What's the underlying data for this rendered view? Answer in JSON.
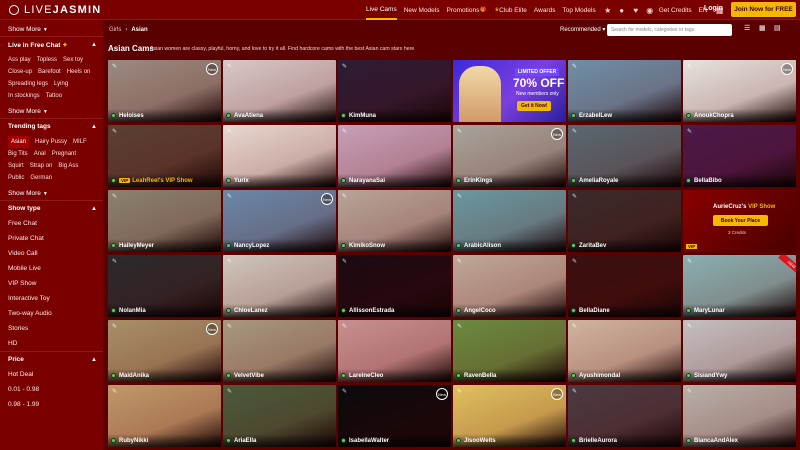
{
  "header": {
    "logo_a": "LIVE",
    "logo_b": "JASMIN",
    "nav": [
      {
        "label": "Live Cams",
        "active": true
      },
      {
        "label": "New Models"
      },
      {
        "label": "Promotions"
      },
      {
        "label": "Club Elite"
      },
      {
        "label": "Awards"
      },
      {
        "label": "Top Models"
      }
    ],
    "get_credits": "Get Credits",
    "lang": "EN",
    "login": "Login",
    "join": "Join Now for FREE"
  },
  "sidebar": {
    "show_more_top": "Show More",
    "free_chat_title": "Live in Free Chat",
    "free_chat_tags": [
      "Ass play",
      "Topless",
      "Sex toy",
      "Close-up",
      "Barefoot",
      "Heels on",
      "Spreading legs",
      "Lying",
      "In stockings",
      "Tattoo"
    ],
    "show_more_1": "Show More",
    "trending_title": "Trending tags",
    "trending_tags": [
      "Asian",
      "Hairy Pussy",
      "MILF",
      "Big Tits",
      "Anal",
      "Pregnant",
      "Squirt",
      "Strap on",
      "Big Ass",
      "Public",
      "German"
    ],
    "show_more_2": "Show More",
    "show_type_title": "Show type",
    "show_types": [
      "Free Chat",
      "Private Chat",
      "Video Call",
      "Mobile Live",
      "VIP Show",
      "Interactive Toy",
      "Two-way Audio",
      "Stories",
      "HD"
    ],
    "price_title": "Price",
    "prices": [
      "Hot Deal",
      "0.01 - 0.98",
      "0.98 - 1.99"
    ]
  },
  "main": {
    "breadcrumb_parent": "Girls",
    "breadcrumb_current": "Asian",
    "sort": "Recommended",
    "search_placeholder": "Search for models, categories or tags",
    "title": "Asian Cams",
    "description": "Asian women are classy, playful, horny, and love to try it all. Find hardcore cams with the best Asian cam stars here",
    "promo": {
      "badge": "LIMITED OFFER",
      "off": "70% OFF",
      "sub": "New members only",
      "btn": "Get it Now!"
    },
    "vip": {
      "name": "AurieCruz's",
      "vip": "VIP Show",
      "btn": "Book Your Place",
      "credits": "3 Credits",
      "tag": "VIP"
    },
    "cards": [
      {
        "name": "Heloises",
        "bg": "#9a8a80",
        "new": true
      },
      {
        "name": "AvaAtiena",
        "bg": "#d8c8c8"
      },
      {
        "name": "KimMuna",
        "bg": "#2c1c34"
      },
      {
        "name": "ErzabelLew",
        "bg": "#6f8fa8"
      },
      {
        "name": "AnoukChopra",
        "bg": "#e6e2de",
        "new": true
      },
      {
        "name": "LeahReel's VIP Show",
        "bg": "#5a4034",
        "vip": true
      },
      {
        "name": "Yurix",
        "bg": "#e8d8d0"
      },
      {
        "name": "NarayanaSai",
        "bg": "#c8a0b8"
      },
      {
        "name": "ErinKings",
        "bg": "#a8a49a",
        "new": true
      },
      {
        "name": "AmeliaRoyale",
        "bg": "#5a6870"
      },
      {
        "name": "BellaBibo",
        "bg": "#4a1a4a"
      },
      {
        "name": "HaileyMeyer",
        "bg": "#8a8270"
      },
      {
        "name": "NancyLopez",
        "bg": "#6a88a8",
        "new": true
      },
      {
        "name": "KimikoSnow",
        "bg": "#b8a49a"
      },
      {
        "name": "ArabicAlison",
        "bg": "#6a98a0"
      },
      {
        "name": "ZaritaBev",
        "bg": "#3a2a2a"
      },
      {
        "name": "NolanMia",
        "bg": "#2a2a2c"
      },
      {
        "name": "ChloeLanez",
        "bg": "#cfc6bc"
      },
      {
        "name": "AllissonEstrada",
        "bg": "#1a0a12"
      },
      {
        "name": "AngelCoco",
        "bg": "#c0a898"
      },
      {
        "name": "BellaDiane",
        "bg": "#3a1010"
      },
      {
        "name": "MaryLunar",
        "bg": "#8ab0b0",
        "ribbon": "NEW"
      },
      {
        "name": "MaidAnika",
        "bg": "#a89068",
        "new": true
      },
      {
        "name": "VelvetVibe",
        "bg": "#a89880"
      },
      {
        "name": "LareineCleo",
        "bg": "#c89090"
      },
      {
        "name": "RavenBella",
        "bg": "#6a8a40"
      },
      {
        "name": "Ayushimondal",
        "bg": "#d0b4a0"
      },
      {
        "name": "SisiandYwy",
        "bg": "#c4c0c0"
      },
      {
        "name": "RubyNikki",
        "bg": "#c0986a"
      },
      {
        "name": "AriaElla",
        "bg": "#4a5a3a"
      },
      {
        "name": "IsabellaWalter",
        "bg": "#0a0a0c",
        "new": true
      },
      {
        "name": "JisooWelts",
        "bg": "#e0c060",
        "new": true
      },
      {
        "name": "BrielleAurora",
        "bg": "#4a3a40"
      },
      {
        "name": "BiancaAndAlex",
        "bg": "#b8b0a8"
      }
    ]
  }
}
